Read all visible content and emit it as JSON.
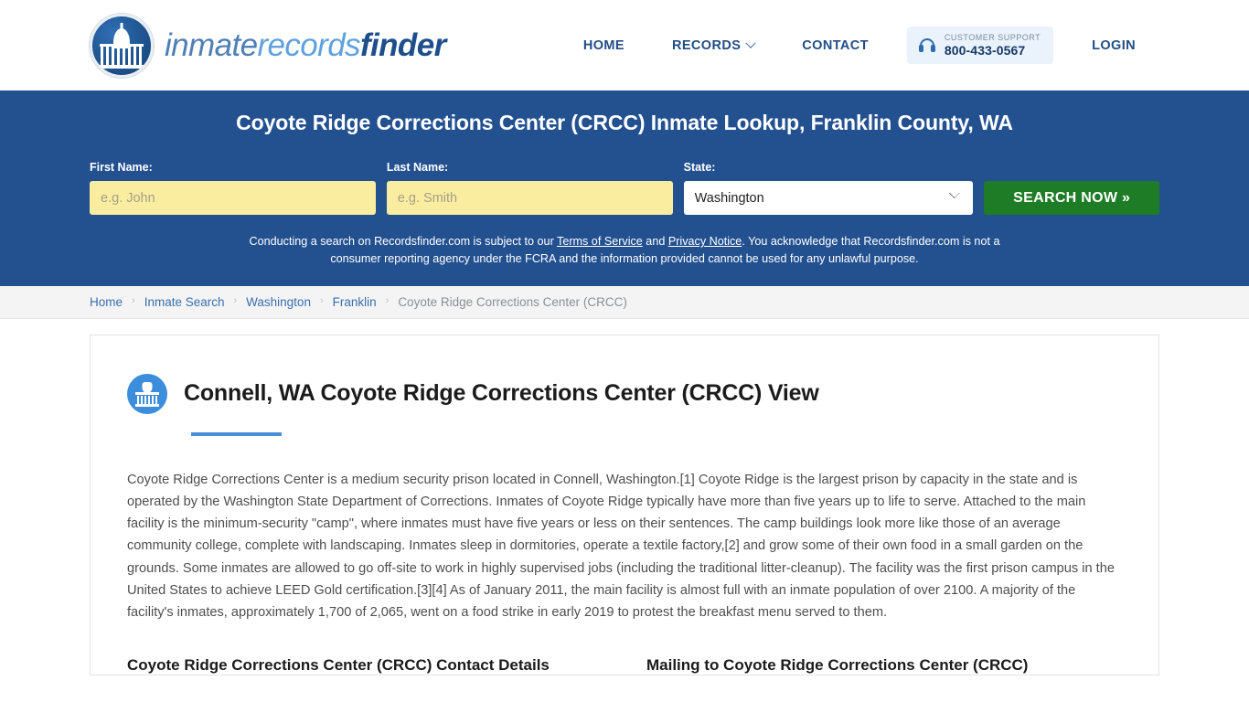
{
  "header": {
    "logo": {
      "icon": "capitol-dome-icon",
      "text_part1": "inmate",
      "text_part2": "records",
      "text_part3": "finder"
    },
    "nav": [
      {
        "label": "HOME",
        "has_dropdown": false
      },
      {
        "label": "RECORDS",
        "has_dropdown": true
      },
      {
        "label": "CONTACT",
        "has_dropdown": false
      }
    ],
    "support": {
      "icon": "headset-icon",
      "label": "CUSTOMER SUPPORT",
      "phone": "800-433-0567"
    },
    "login_label": "LOGIN"
  },
  "hero": {
    "title": "Coyote Ridge Corrections Center (CRCC) Inmate Lookup, Franklin County, WA",
    "first_name": {
      "label": "First Name:",
      "value": "",
      "placeholder": "e.g. John"
    },
    "last_name": {
      "label": "Last Name:",
      "value": "",
      "placeholder": "e.g. Smith"
    },
    "state": {
      "label": "State:",
      "selected": "Washington"
    },
    "search_button": "SEARCH NOW »",
    "disclaimer": {
      "part1": "Conducting a search on Recordsfinder.com is subject to our ",
      "link1": "Terms of Service",
      "part2": " and ",
      "link2": "Privacy Notice",
      "part3": ". You acknowledge that Recordsfinder.com is not a consumer reporting agency under the FCRA and the information provided cannot be used for any unlawful purpose."
    }
  },
  "breadcrumb": [
    {
      "label": "Home",
      "current": false
    },
    {
      "label": "Inmate Search",
      "current": false
    },
    {
      "label": "Washington",
      "current": false
    },
    {
      "label": "Franklin",
      "current": false
    },
    {
      "label": "Coyote Ridge Corrections Center (CRCC)",
      "current": true
    }
  ],
  "breadcrumb_separator": "›",
  "main": {
    "icon": "courthouse-icon",
    "title": "Connell, WA Coyote Ridge Corrections Center (CRCC) View",
    "body": "Coyote Ridge Corrections Center is a medium security prison located in Connell, Washington.[1] Coyote Ridge is the largest prison by capacity in the state and is operated by the Washington State Department of Corrections. Inmates of Coyote Ridge typically have more than five years up to life to serve. Attached to the main facility is the minimum-security \"camp\", where inmates must have five years or less on their sentences. The camp buildings look more like those of an average community college, complete with landscaping. Inmates sleep in dormitories, operate a textile factory,[2] and grow some of their own food in a small garden on the grounds. Some inmates are allowed to go off-site to work in highly supervised jobs (including the traditional litter-cleanup). The facility was the first prison campus in the United States to achieve LEED Gold certification.[3][4] As of January 2011, the main facility is almost full with an inmate population of over 2100. A majority of the facility's inmates, approximately 1,700 of 2,065, went on a food strike in early 2019 to protest the breakfast menu served to them.",
    "contact_heading": "Coyote Ridge Corrections Center (CRCC) Contact Details",
    "mailing_heading": "Mailing to Coyote Ridge Corrections Center (CRCC)"
  },
  "colors": {
    "hero_blue": "#235190",
    "brand_dark_blue": "#1f4e8c",
    "brand_light_blue": "#5fa1de",
    "search_green": "#1d7c25",
    "input_yellow": "#fbeda0",
    "accent_blue": "#4a90d9"
  }
}
